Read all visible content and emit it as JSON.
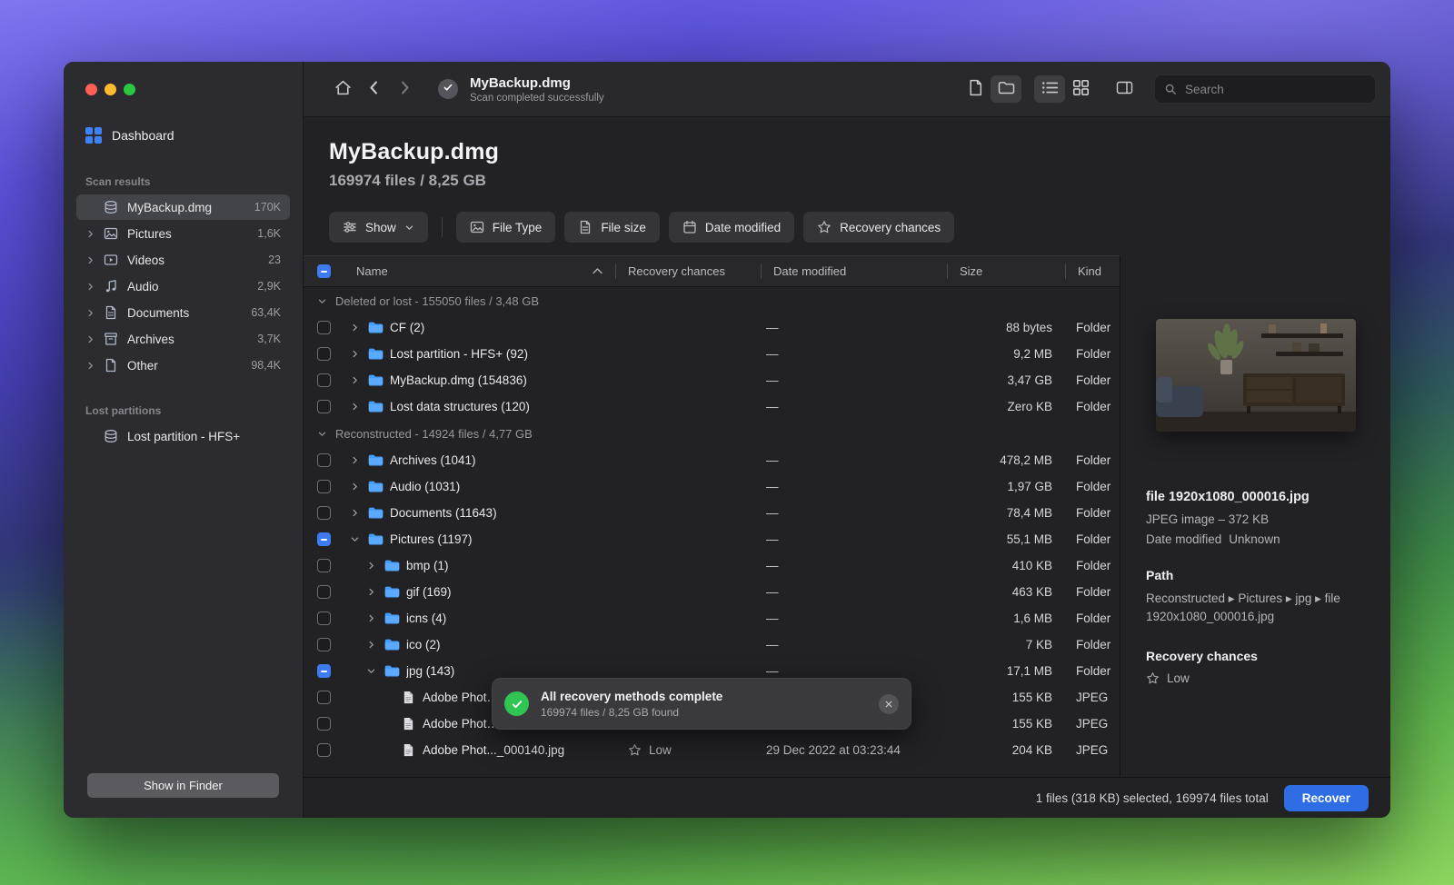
{
  "colors": {
    "accent": "#2e6de4",
    "folder": "#4da3ff",
    "success": "#30c553"
  },
  "titlebar": {
    "title": "MyBackup.dmg",
    "subtitle": "Scan completed successfully",
    "search_placeholder": "Search"
  },
  "sidebar": {
    "dashboard_label": "Dashboard",
    "scan_results_header": "Scan results",
    "items": [
      {
        "label": "MyBackup.dmg",
        "count": "170K",
        "icon": "drive",
        "selected": true,
        "chevron": false
      },
      {
        "label": "Pictures",
        "count": "1,6K",
        "icon": "pictures",
        "chevron": true
      },
      {
        "label": "Videos",
        "count": "23",
        "icon": "videos",
        "chevron": true
      },
      {
        "label": "Audio",
        "count": "2,9K",
        "icon": "audio",
        "chevron": true
      },
      {
        "label": "Documents",
        "count": "63,4K",
        "icon": "documents",
        "chevron": true
      },
      {
        "label": "Archives",
        "count": "3,7K",
        "icon": "archives",
        "chevron": true
      },
      {
        "label": "Other",
        "count": "98,4K",
        "icon": "other",
        "chevron": true
      }
    ],
    "lost_partitions_header": "Lost partitions",
    "lost_partition": {
      "label": "Lost partition - HFS+",
      "icon": "drive"
    },
    "show_in_finder_label": "Show in Finder"
  },
  "header": {
    "title": "MyBackup.dmg",
    "stats": "169974 files / 8,25 GB"
  },
  "filters": {
    "show": {
      "label": "Show",
      "icon": "sliders"
    },
    "buttons": [
      {
        "label": "File Type",
        "icon": "image"
      },
      {
        "label": "File size",
        "icon": "doc"
      },
      {
        "label": "Date modified",
        "icon": "calendar"
      },
      {
        "label": "Recovery chances",
        "icon": "star"
      }
    ]
  },
  "table": {
    "columns": {
      "name": "Name",
      "recovery": "Recovery chances",
      "date": "Date modified",
      "size": "Size",
      "kind": "Kind"
    },
    "header_checkbox": "partial",
    "rows": [
      {
        "type": "group",
        "name": "Deleted or lost - 155050 files / 3,48 GB"
      },
      {
        "type": "folder",
        "indent": 1,
        "name": "CF (2)",
        "date": "—",
        "size": "88 bytes",
        "kind": "Folder"
      },
      {
        "type": "folder",
        "indent": 1,
        "name": "Lost partition - HFS+ (92)",
        "date": "—",
        "size": "9,2 MB",
        "kind": "Folder"
      },
      {
        "type": "folder",
        "indent": 1,
        "name": "MyBackup.dmg (154836)",
        "date": "—",
        "size": "3,47 GB",
        "kind": "Folder"
      },
      {
        "type": "folder",
        "indent": 1,
        "name": "Lost data structures (120)",
        "date": "—",
        "size": "Zero KB",
        "kind": "Folder"
      },
      {
        "type": "group",
        "name": "Reconstructed - 14924 files / 4,77 GB"
      },
      {
        "type": "folder",
        "indent": 1,
        "name": "Archives (1041)",
        "date": "—",
        "size": "478,2 MB",
        "kind": "Folder"
      },
      {
        "type": "folder",
        "indent": 1,
        "name": "Audio (1031)",
        "date": "—",
        "size": "1,97 GB",
        "kind": "Folder"
      },
      {
        "type": "folder",
        "indent": 1,
        "name": "Documents (11643)",
        "date": "—",
        "size": "78,4 MB",
        "kind": "Folder"
      },
      {
        "type": "folder",
        "indent": 1,
        "name": "Pictures (1197)",
        "date": "—",
        "size": "55,1 MB",
        "kind": "Folder",
        "checked": "partial",
        "expanded": true
      },
      {
        "type": "folder",
        "indent": 2,
        "name": "bmp (1)",
        "date": "—",
        "size": "410 KB",
        "kind": "Folder"
      },
      {
        "type": "folder",
        "indent": 2,
        "name": "gif (169)",
        "date": "—",
        "size": "463 KB",
        "kind": "Folder"
      },
      {
        "type": "folder",
        "indent": 2,
        "name": "icns (4)",
        "date": "—",
        "size": "1,6 MB",
        "kind": "Folder"
      },
      {
        "type": "folder",
        "indent": 2,
        "name": "ico (2)",
        "date": "—",
        "size": "7 KB",
        "kind": "Folder"
      },
      {
        "type": "folder",
        "indent": 2,
        "name": "jpg (143)",
        "date": "—",
        "size": "17,1 MB",
        "kind": "Folder",
        "checked": "partial",
        "expanded": true
      },
      {
        "type": "file",
        "indent": 3,
        "name": "Adobe Phot…",
        "size": "155 KB",
        "kind": "JPEG"
      },
      {
        "type": "file",
        "indent": 3,
        "name": "Adobe Phot…",
        "size": "155 KB",
        "kind": "JPEG"
      },
      {
        "type": "file",
        "indent": 3,
        "name": "Adobe Phot..._000140.jpg",
        "recovery": "Low",
        "date": "29 Dec 2022 at 03:23:44",
        "size": "204 KB",
        "kind": "JPEG"
      }
    ]
  },
  "toast": {
    "title": "All recovery methods complete",
    "subtitle": "169974 files / 8,25 GB found"
  },
  "preview": {
    "filename": "file 1920x1080_000016.jpg",
    "file_info": "JPEG image – 372 KB",
    "date_modified_label": "Date modified",
    "date_modified_value": "Unknown",
    "path_label": "Path",
    "path_value": "Reconstructed ▸ Pictures ▸ jpg ▸ file 1920x1080_000016.jpg",
    "recovery_label": "Recovery chances",
    "recovery_value": "Low"
  },
  "footer": {
    "selection_summary": "1 files (318 KB) selected, 169974 files total",
    "recover_label": "Recover"
  }
}
